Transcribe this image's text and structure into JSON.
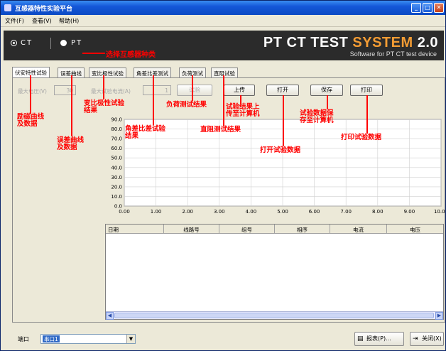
{
  "window": {
    "title": "互感器特性实验平台"
  },
  "menu": [
    "文件(F)",
    "查看(V)",
    "帮助(H)"
  ],
  "banner": {
    "radio_ct": "CT",
    "radio_pt": "PT",
    "logo_main": "PT CT TEST ",
    "logo_accent": "SYSTEM",
    "logo_version": " 2.0",
    "tagline": "Software for PT CT test device"
  },
  "tabs": [
    "伏安特性试验",
    "误差曲线",
    "变比极性试验",
    "角差比差测试",
    "负荷测试",
    "直阻试验"
  ],
  "controls": {
    "max_voltage_label": "最大电压(V)",
    "max_voltage_value": "30",
    "max_current_label": "最大试验电流(A)",
    "max_current_value": "1",
    "start_button": "试验",
    "upload_button": "上传",
    "open_button": "打开",
    "save_button": "保存",
    "print_button": "打印"
  },
  "chart_data": {
    "type": "line",
    "x_ticks": [
      "0.00",
      "1.00",
      "2.00",
      "3.00",
      "4.00",
      "5.00",
      "6.00",
      "7.00",
      "8.00",
      "9.00",
      "10.00"
    ],
    "y_ticks": [
      "0.0",
      "10.0",
      "20.0",
      "30.0",
      "40.0",
      "50.0",
      "60.0",
      "70.0",
      "80.0",
      "90.0"
    ],
    "xlim": [
      0,
      10
    ],
    "ylim": [
      0,
      90
    ],
    "series": [],
    "grid": true
  },
  "table": {
    "columns": [
      "日期",
      "线路号",
      "组号",
      "相序",
      "电流",
      "电压"
    ],
    "rows": []
  },
  "statusbar": {
    "port_label": "端口",
    "port_value": "串口1",
    "report_button": "报表(P)...",
    "close_button": "关闭(X)"
  },
  "annotations": {
    "select_type": "选择互感器种类",
    "excitation": "励磁曲线\n及数据",
    "error_curve": "误差曲线\n及数据",
    "ratio_polarity": "变比极性试验\n结果",
    "angle_ratio": "角差比差试验\n结果",
    "load": "负荷测试结果",
    "upload": "试验结果上\n传至计算机",
    "dc_resistance": "直阻测试结果",
    "open": "打开试验数据",
    "save": "试验数据保\n存至计算机",
    "print": "打印试验数据"
  },
  "colors": {
    "annotation": "#ff0000",
    "accent": "#f39c34",
    "banner_bg": "#2b2b2b",
    "title_bar": "#1457d8"
  }
}
